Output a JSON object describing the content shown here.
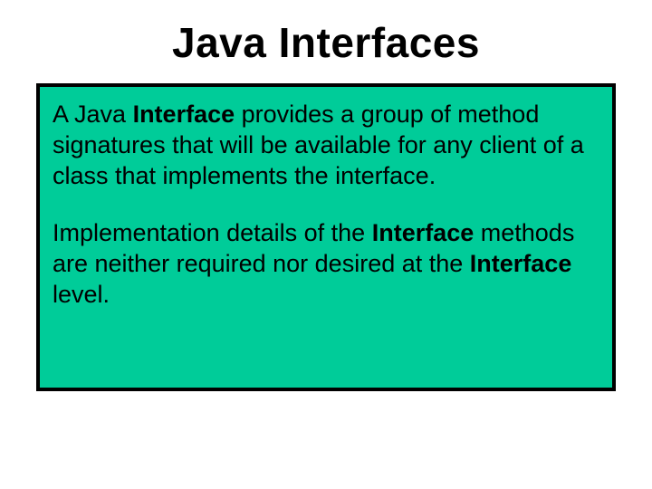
{
  "title": "Java Interfaces",
  "p1_pre": "A Java ",
  "p1_bold": "Interface",
  "p1_post": " provides a group of method signatures that will be available for any client of a class that implements the interface.",
  "p2_pre": "Implementation details of the ",
  "p2_bold1": "Interface",
  "p2_mid": " methods are neither required nor desired at the ",
  "p2_bold2": "Interface",
  "p2_post": " level."
}
